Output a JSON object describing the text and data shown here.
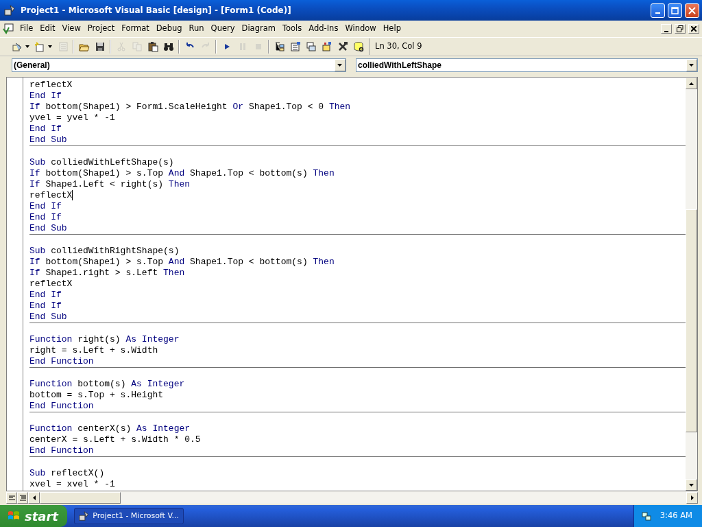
{
  "window": {
    "title": "Project1 - Microsoft Visual Basic [design] - [Form1 (Code)]"
  },
  "menu": [
    {
      "label": "File"
    },
    {
      "label": "Edit"
    },
    {
      "label": "View"
    },
    {
      "label": "Project"
    },
    {
      "label": "Format"
    },
    {
      "label": "Debug"
    },
    {
      "label": "Run"
    },
    {
      "label": "Query"
    },
    {
      "label": "Diagram"
    },
    {
      "label": "Tools"
    },
    {
      "label": "Add-Ins"
    },
    {
      "label": "Window"
    },
    {
      "label": "Help"
    }
  ],
  "toolbar": [
    {
      "kind": "addproject",
      "disabled": false,
      "dropdown": true
    },
    {
      "kind": "addform",
      "disabled": false,
      "dropdown": true
    },
    {
      "kind": "menueditor",
      "disabled": true,
      "dropdown": false
    },
    {
      "kind": "sep"
    },
    {
      "kind": "open",
      "disabled": false,
      "dropdown": false
    },
    {
      "kind": "save",
      "disabled": false,
      "dropdown": false
    },
    {
      "kind": "sep"
    },
    {
      "kind": "cut",
      "disabled": true,
      "dropdown": false
    },
    {
      "kind": "copy",
      "disabled": true,
      "dropdown": false
    },
    {
      "kind": "paste",
      "disabled": false,
      "dropdown": false
    },
    {
      "kind": "find",
      "disabled": false,
      "dropdown": false
    },
    {
      "kind": "sep"
    },
    {
      "kind": "undo",
      "disabled": false,
      "dropdown": false
    },
    {
      "kind": "redo",
      "disabled": true,
      "dropdown": false
    },
    {
      "kind": "sep"
    },
    {
      "kind": "run",
      "disabled": false,
      "dropdown": false
    },
    {
      "kind": "pause",
      "disabled": true,
      "dropdown": false
    },
    {
      "kind": "stop",
      "disabled": true,
      "dropdown": false
    },
    {
      "kind": "sep"
    },
    {
      "kind": "project",
      "disabled": false,
      "dropdown": false
    },
    {
      "kind": "properties",
      "disabled": false,
      "dropdown": false
    },
    {
      "kind": "layout",
      "disabled": false,
      "dropdown": false
    },
    {
      "kind": "browser",
      "disabled": false,
      "dropdown": false
    },
    {
      "kind": "toolbox",
      "disabled": false,
      "dropdown": false
    },
    {
      "kind": "dataview",
      "disabled": false,
      "dropdown": false
    }
  ],
  "position": "Ln 30, Col 9",
  "object_dropdown": {
    "value": "(General)"
  },
  "procedure_dropdown": {
    "value": "colliedWithLeftShape"
  },
  "procedures": [
    {
      "lines": [
        {
          "tokens": [
            {
              "kind": "text",
              "text": "reflectX"
            }
          ]
        },
        {
          "tokens": [
            {
              "kind": "keyword",
              "text": "End If"
            }
          ]
        },
        {
          "tokens": [
            {
              "kind": "keyword",
              "text": "If"
            },
            {
              "kind": "text",
              "text": " bottom(Shape1) > Form1.ScaleHeight "
            },
            {
              "kind": "keyword",
              "text": "Or"
            },
            {
              "kind": "text",
              "text": " Shape1.Top < 0 "
            },
            {
              "kind": "keyword",
              "text": "Then"
            }
          ]
        },
        {
          "tokens": [
            {
              "kind": "text",
              "text": "yvel = yvel * -1"
            }
          ]
        },
        {
          "tokens": [
            {
              "kind": "keyword",
              "text": "End If"
            }
          ]
        },
        {
          "tokens": [
            {
              "kind": "keyword",
              "text": "End Sub"
            }
          ]
        }
      ]
    },
    {
      "lines": [
        {
          "tokens": [
            {
              "kind": "keyword",
              "text": "Sub"
            },
            {
              "kind": "text",
              "text": " colliedWithLeftShape(s)"
            }
          ]
        },
        {
          "tokens": [
            {
              "kind": "keyword",
              "text": "If"
            },
            {
              "kind": "text",
              "text": " bottom(Shape1) > s.Top "
            },
            {
              "kind": "keyword",
              "text": "And"
            },
            {
              "kind": "text",
              "text": " Shape1.Top < bottom(s) "
            },
            {
              "kind": "keyword",
              "text": "Then"
            }
          ]
        },
        {
          "tokens": [
            {
              "kind": "keyword",
              "text": "If"
            },
            {
              "kind": "text",
              "text": " Shape1.Left < right(s) "
            },
            {
              "kind": "keyword",
              "text": "Then"
            }
          ]
        },
        {
          "tokens": [
            {
              "kind": "text",
              "text": "reflectX"
            }
          ],
          "caret": true
        },
        {
          "tokens": [
            {
              "kind": "keyword",
              "text": "End If"
            }
          ]
        },
        {
          "tokens": [
            {
              "kind": "keyword",
              "text": "End If"
            }
          ]
        },
        {
          "tokens": [
            {
              "kind": "keyword",
              "text": "End Sub"
            }
          ]
        }
      ]
    },
    {
      "lines": [
        {
          "tokens": [
            {
              "kind": "keyword",
              "text": "Sub"
            },
            {
              "kind": "text",
              "text": " colliedWithRightShape(s)"
            }
          ]
        },
        {
          "tokens": [
            {
              "kind": "keyword",
              "text": "If"
            },
            {
              "kind": "text",
              "text": " bottom(Shape1) > s.Top "
            },
            {
              "kind": "keyword",
              "text": "And"
            },
            {
              "kind": "text",
              "text": " Shape1.Top < bottom(s) "
            },
            {
              "kind": "keyword",
              "text": "Then"
            }
          ]
        },
        {
          "tokens": [
            {
              "kind": "keyword",
              "text": "If"
            },
            {
              "kind": "text",
              "text": " Shape1.right > s.Left "
            },
            {
              "kind": "keyword",
              "text": "Then"
            }
          ]
        },
        {
          "tokens": [
            {
              "kind": "text",
              "text": "reflectX"
            }
          ]
        },
        {
          "tokens": [
            {
              "kind": "keyword",
              "text": "End If"
            }
          ]
        },
        {
          "tokens": [
            {
              "kind": "keyword",
              "text": "End If"
            }
          ]
        },
        {
          "tokens": [
            {
              "kind": "keyword",
              "text": "End Sub"
            }
          ]
        }
      ]
    },
    {
      "lines": [
        {
          "tokens": [
            {
              "kind": "keyword",
              "text": "Function"
            },
            {
              "kind": "text",
              "text": " right(s) "
            },
            {
              "kind": "keyword",
              "text": "As Integer"
            }
          ]
        },
        {
          "tokens": [
            {
              "kind": "text",
              "text": "right = s.Left + s.Width"
            }
          ]
        },
        {
          "tokens": [
            {
              "kind": "keyword",
              "text": "End Function"
            }
          ]
        }
      ]
    },
    {
      "lines": [
        {
          "tokens": [
            {
              "kind": "keyword",
              "text": "Function"
            },
            {
              "kind": "text",
              "text": " bottom(s) "
            },
            {
              "kind": "keyword",
              "text": "As Integer"
            }
          ]
        },
        {
          "tokens": [
            {
              "kind": "text",
              "text": "bottom = s.Top + s.Height"
            }
          ]
        },
        {
          "tokens": [
            {
              "kind": "keyword",
              "text": "End Function"
            }
          ]
        }
      ]
    },
    {
      "lines": [
        {
          "tokens": [
            {
              "kind": "keyword",
              "text": "Function"
            },
            {
              "kind": "text",
              "text": " centerX(s) "
            },
            {
              "kind": "keyword",
              "text": "As Integer"
            }
          ]
        },
        {
          "tokens": [
            {
              "kind": "text",
              "text": "centerX = s.Left + s.Width * 0.5"
            }
          ]
        },
        {
          "tokens": [
            {
              "kind": "keyword",
              "text": "End Function"
            }
          ]
        }
      ]
    },
    {
      "lines": [
        {
          "tokens": [
            {
              "kind": "keyword",
              "text": "Sub"
            },
            {
              "kind": "text",
              "text": " reflectX()"
            }
          ]
        },
        {
          "tokens": [
            {
              "kind": "text",
              "text": "xvel = xvel * -1"
            }
          ]
        }
      ]
    }
  ],
  "taskbar": {
    "start": "start",
    "tasks": [
      {
        "label": "Project1 - Microsoft V...",
        "selected": false
      }
    ],
    "clock": "3:46 AM"
  }
}
